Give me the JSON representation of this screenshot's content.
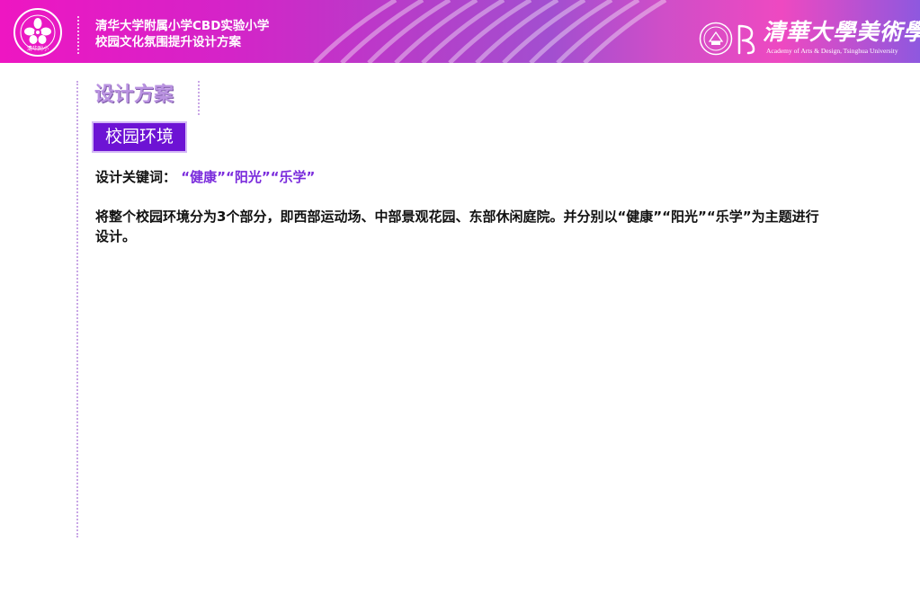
{
  "header": {
    "title_line1": "清华大学附属小学CBD实验小学",
    "title_line2": "校园文化氛围提升设计方案",
    "school_logo_icon": "school-emblem-icon",
    "school_logo_text": "清华附小",
    "academy_calligraphy": "清華大學美術學院",
    "academy_english": "Academy of Arts & Design, Tsinghua University",
    "seal_icon": "tsinghua-seal-icon",
    "gradient_colors": [
      "#ee16c2",
      "#b53ec9",
      "#a24fd0",
      "#ee49c1",
      "#8e58df"
    ]
  },
  "section": {
    "title": "设计方案",
    "tag": "校园环境"
  },
  "keywords": {
    "label": "设计关键词：",
    "value": "“健康”“阳光”“乐学”"
  },
  "body": {
    "text": "将整个校园环境分为3个部分，即西部运动场、中部景观花园、东部休闲庭院。并分别以“健康”“阳光”“乐学”为主题进行设计。"
  },
  "colors": {
    "accent": "#6d13d4",
    "title": "#ba93e1",
    "keyword": "#7a2bdc"
  }
}
